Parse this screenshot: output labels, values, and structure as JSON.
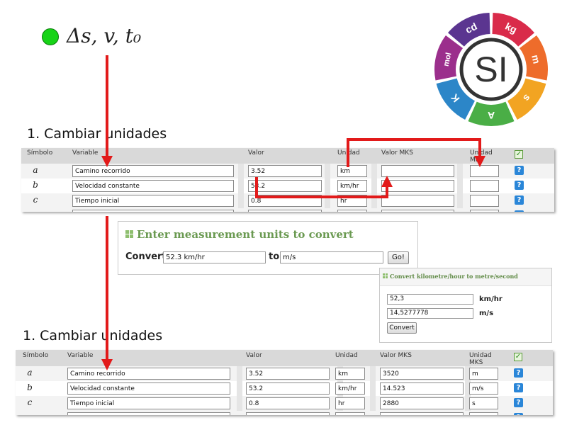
{
  "header": {
    "formula": "Δs, v, t₀"
  },
  "si_logo": {
    "center_text": "SI",
    "segments": [
      {
        "label": "kg",
        "color": "#d92b4a"
      },
      {
        "label": "m",
        "color": "#ee6c2b"
      },
      {
        "label": "s",
        "color": "#f2a422"
      },
      {
        "label": "A",
        "color": "#4aae46"
      },
      {
        "label": "K",
        "color": "#2c86c8"
      },
      {
        "label": "mol",
        "color": "#9b2f8c"
      },
      {
        "label": "cd",
        "color": "#5b3590"
      }
    ]
  },
  "table_headers": {
    "simbolo": "Símbolo",
    "variable": "Variable",
    "valor": "Valor",
    "unidad": "Unidad",
    "valor_mks": "Valor MKS",
    "unidad_mks": "Unidad MKS"
  },
  "panel_top": {
    "title": "1. Cambiar unidades",
    "rows": [
      {
        "symbol": "a",
        "variable": "Camino recorrido",
        "value": "3.52",
        "unit": "km",
        "mks_value": "",
        "mks_unit": ""
      },
      {
        "symbol": "b",
        "variable": "Velocidad constante",
        "value": "53.2",
        "unit": "km/hr",
        "mks_value": "",
        "mks_unit": ""
      },
      {
        "symbol": "c",
        "variable": "Tiempo inicial",
        "value": "0.8",
        "unit": "hr",
        "mks_value": "",
        "mks_unit": ""
      }
    ]
  },
  "converter_main": {
    "title": "Enter measurement units to convert",
    "convert_label": "Convert",
    "from_value": "52.3 km/hr",
    "to_label": "to",
    "to_value": "m/s",
    "go_label": "Go!"
  },
  "converter_small": {
    "title": "Convert kilometre/hour to metre/second",
    "input_value": "52,3",
    "input_unit": "km/hr",
    "output_value": "14,5277778",
    "output_unit": "m/s",
    "button_label": "Convert"
  },
  "panel_bottom": {
    "title": "1. Cambiar unidades",
    "rows": [
      {
        "symbol": "a",
        "variable": "Camino recorrido",
        "value": "3.52",
        "unit": "km",
        "mks_value": "3520",
        "mks_unit": "m"
      },
      {
        "symbol": "b",
        "variable": "Velocidad constante",
        "value": "53.2",
        "unit": "km/hr",
        "mks_value": "14.523",
        "mks_unit": "m/s"
      },
      {
        "symbol": "c",
        "variable": "Tiempo inicial",
        "value": "0.8",
        "unit": "hr",
        "mks_value": "2880",
        "mks_unit": "s"
      }
    ]
  },
  "colors": {
    "arrow": "#e21a1a",
    "header_bg": "#d9d9d9",
    "help": "#2a86d8",
    "converter_title": "#6b9a52"
  },
  "icons": {
    "help": "question-icon",
    "check": "checkbox-icon",
    "grid": "grid-icon"
  },
  "help_glyph": "?",
  "check_glyph": "✓"
}
